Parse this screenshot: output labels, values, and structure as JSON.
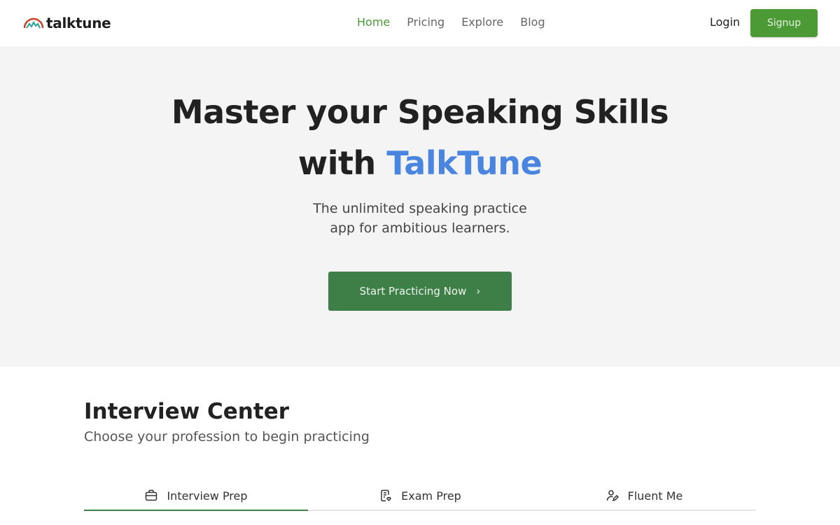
{
  "nav": {
    "logo_text": "talktune",
    "links": [
      {
        "label": "Home",
        "active": true
      },
      {
        "label": "Pricing",
        "active": false
      },
      {
        "label": "Explore",
        "active": false
      },
      {
        "label": "Blog",
        "active": false
      }
    ],
    "login_label": "Login",
    "signup_label": "Signup"
  },
  "hero": {
    "title_line1": "Master your Speaking Skills",
    "title_line2_prefix": "with",
    "title_line2_accent": "TalkTune",
    "subtitle_line1": "The unlimited speaking practice",
    "subtitle_line2": "app for ambitious learners.",
    "cta_label": "Start Practicing Now",
    "cta_icon": "chevron-right-icon"
  },
  "section": {
    "title": "Interview Center",
    "subtitle": "Choose your profession to begin practicing"
  },
  "tabs": [
    {
      "label": "Interview Prep",
      "icon": "briefcase-icon",
      "active": true
    },
    {
      "label": "Exam Prep",
      "icon": "exam-document-icon",
      "active": false
    },
    {
      "label": "Fluent Me",
      "icon": "user-edit-icon",
      "active": false
    }
  ],
  "colors": {
    "brand_green": "#4b9a35",
    "cta_green": "#3e7e47",
    "accent_blue": "#4a86e0"
  }
}
